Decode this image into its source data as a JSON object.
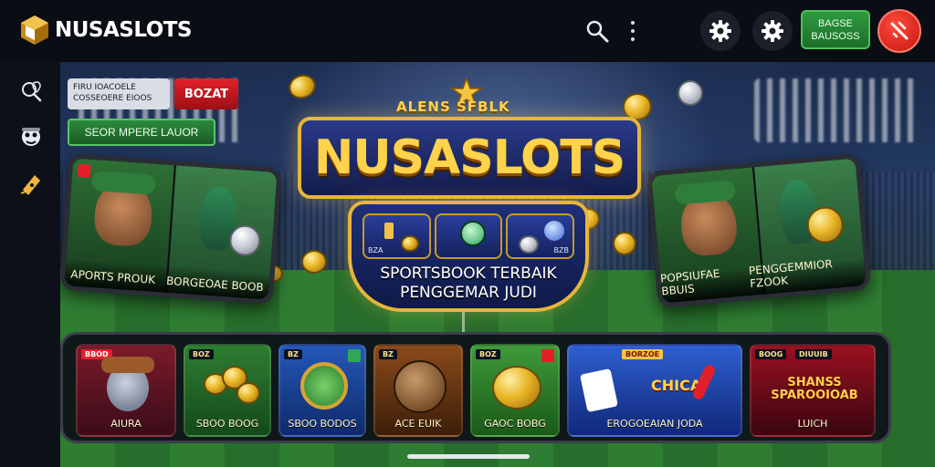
{
  "app": {
    "name": "NUSASLOTS"
  },
  "header": {
    "balance_line1": "BAGSE",
    "balance_line2": "BAUSOSS"
  },
  "promo": {
    "info_line1": "FIRU IOACOELE",
    "info_line2": "COSSEOERE EIOOS",
    "red_chip": "BOZAT",
    "green_chip": "SEOR MPERE LAUOR"
  },
  "hero": {
    "top_text": "ALENS SFBLK",
    "title": "NUSASLOTS",
    "reel_labels": [
      "BZA",
      "",
      "BZB"
    ],
    "subtitle_line1": "SPORTSBOOK TERBAIK",
    "subtitle_line2": "PENGGEMAR JUDI"
  },
  "phones": {
    "left_caption_1": "APORTS PROUK",
    "left_caption_2": "BORGEOAE BOOB",
    "right_caption_1": "POPSIUFAE BBUIS",
    "right_caption_2": "PENGGEMMIOR FZOOK"
  },
  "games": [
    {
      "tag": "BBOD",
      "label": "AIURA"
    },
    {
      "tag": "BOZ",
      "label": "SBOO BOOG"
    },
    {
      "tag": "BZ",
      "label": "SBOO BODOS"
    },
    {
      "tag": "BZ",
      "label": "ACE EUIK"
    },
    {
      "tag": "BOZ",
      "label": "GAOC BOBG"
    },
    {
      "tag": "BORZOE",
      "label": "EROGOEAIAN JODA",
      "sign": "CHICA"
    },
    {
      "tag": "BOOG",
      "tag2": "DIUUIB",
      "label": "LUICH",
      "sign": "SHANSS SPAROOIOAB"
    }
  ],
  "colors": {
    "accent_gold": "#e7b53a",
    "brand_red": "#e2202a",
    "brand_green": "#2f9a3f",
    "background": "#0b0d14"
  },
  "icons": {
    "topbar": [
      "search-icon",
      "more-vertical-icon",
      "gear-icon",
      "gear-icon",
      "no-sign-icon"
    ],
    "rail": [
      "search-location-icon",
      "mascot-icon",
      "ticket-icon"
    ]
  }
}
